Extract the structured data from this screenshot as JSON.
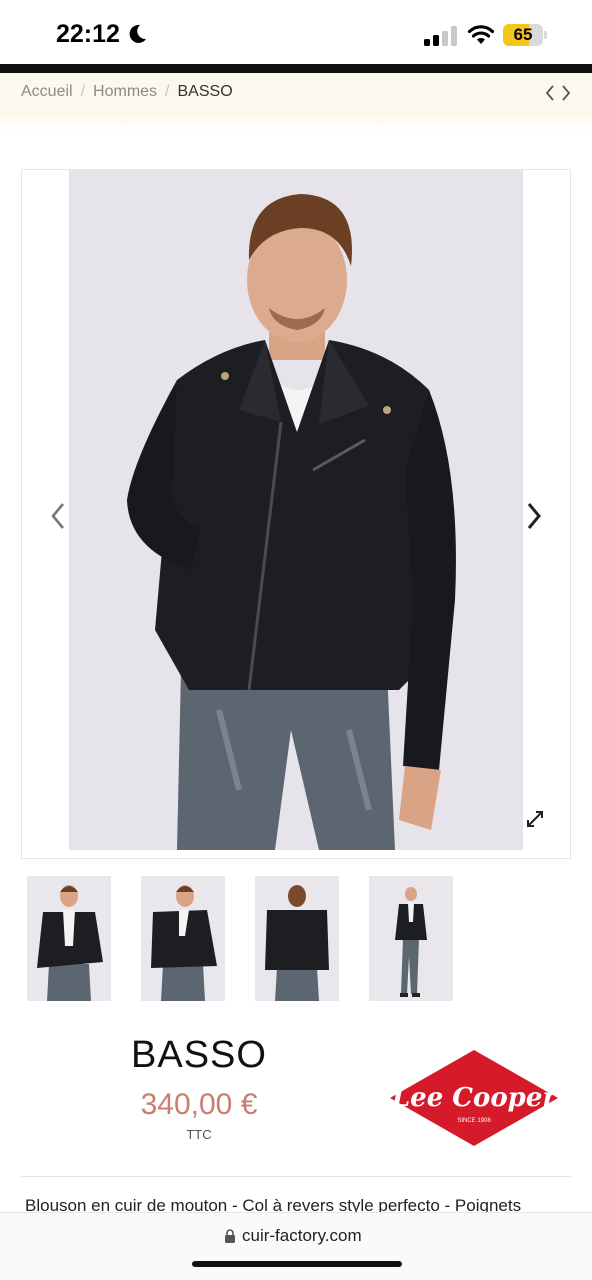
{
  "status_bar": {
    "time": "22:12",
    "battery": "65",
    "battery_level": 0.65
  },
  "breadcrumb": {
    "items": [
      "Accueil",
      "Hommes"
    ],
    "current": "BASSO"
  },
  "product": {
    "title": "BASSO",
    "price": "340,00 €",
    "tax_label": "TTC",
    "description": "Blouson en cuir de mouton - Col à revers style perfecto - Poignets",
    "thumbnail_count": 4
  },
  "brand": {
    "logo_text": "Lee Cooper",
    "logo_subtext": "SINCE 1908",
    "logo_color": "#d51a2a"
  },
  "browser": {
    "url": "cuir-factory.com"
  },
  "colors": {
    "price": "#c87e70",
    "breadcrumb_bg": "#fdf8ee"
  }
}
